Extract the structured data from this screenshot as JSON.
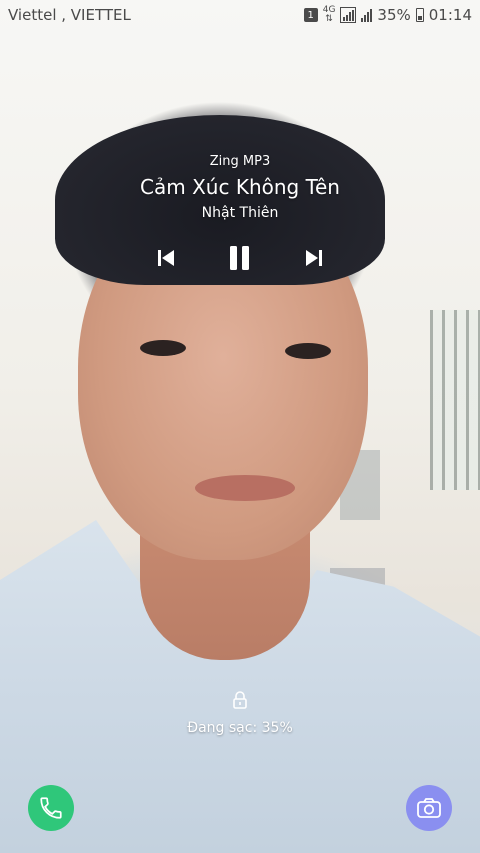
{
  "status_bar": {
    "carrier": "Viettel , VIETTEL",
    "sim_badge": "1",
    "network_type_top": "4G",
    "battery_percent": "35%",
    "time": "01:14"
  },
  "music": {
    "app": "Zing MP3",
    "title": "Cảm Xúc Không Tên",
    "artist": "Nhật Thiên"
  },
  "lock": {
    "charging_text": "Đang sạc: 35%"
  },
  "icons": {
    "prev": "skip-previous-icon",
    "pause": "pause-icon",
    "next": "skip-next-icon",
    "lock": "lock-icon",
    "phone": "phone-icon",
    "camera": "camera-icon"
  },
  "colors": {
    "phone_button": "#2fc77a",
    "camera_button": "#8a8ff0"
  }
}
